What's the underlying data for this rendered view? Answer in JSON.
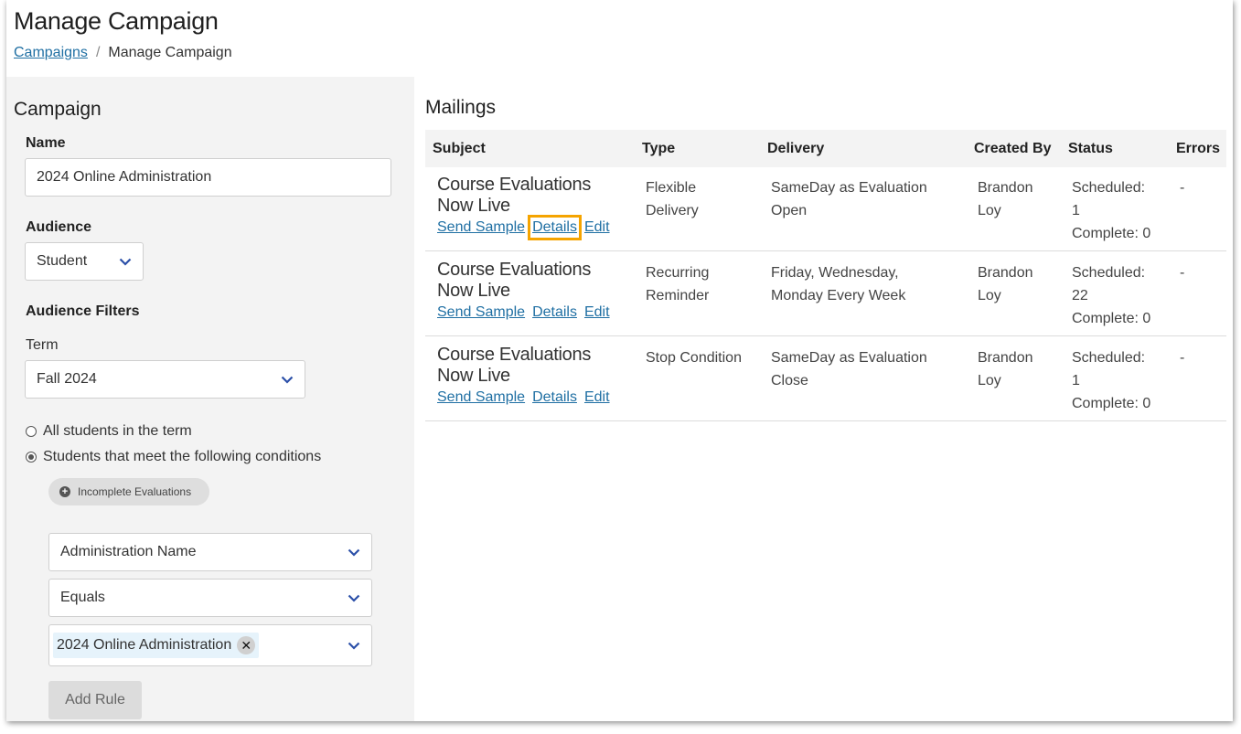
{
  "header": {
    "title": "Manage Campaign",
    "breadcrumb": {
      "link": "Campaigns",
      "separator": "/",
      "current": "Manage Campaign"
    }
  },
  "campaign": {
    "section_title": "Campaign",
    "name_label": "Name",
    "name_value": "2024 Online Administration",
    "audience_label": "Audience",
    "audience_value": "Student",
    "filters_label": "Audience Filters",
    "term_label": "Term",
    "term_value": "Fall 2024",
    "radio_all": "All students in the term",
    "radio_conditions": "Students that meet the following conditions",
    "selected_radio": "conditions",
    "condition_pill": "Incomplete Evaluations",
    "rule_field": "Administration Name",
    "rule_operator": "Equals",
    "rule_value_tag": "2024 Online Administration",
    "add_rule_label": "Add Rule"
  },
  "mailings": {
    "title": "Mailings",
    "columns": [
      "Subject",
      "Type",
      "Delivery",
      "Created By",
      "Status",
      "Errors"
    ],
    "rows": [
      {
        "subject_line1": "Course Evaluations",
        "subject_line2": "Now Live",
        "type_line1": "Flexible",
        "type_line2": "Delivery",
        "delivery_line1": "SameDay as Evaluation",
        "delivery_line2": "Open",
        "created_line1": "Brandon",
        "created_line2": "Loy",
        "status_line1": "Scheduled:",
        "status_line2": "1",
        "status_line3": "Complete: 0",
        "errors": "-",
        "links": {
          "sample": "Send Sample",
          "details": "Details",
          "edit": "Edit"
        }
      },
      {
        "subject_line1": "Course Evaluations",
        "subject_line2": "Now Live",
        "type_line1": "Recurring",
        "type_line2": "Reminder",
        "delivery_line1": "Friday, Wednesday,",
        "delivery_line2": "Monday Every Week",
        "created_line1": "Brandon",
        "created_line2": "Loy",
        "status_line1": "Scheduled:",
        "status_line2": "22",
        "status_line3": "Complete: 0",
        "errors": "-",
        "links": {
          "sample": "Send Sample",
          "details": "Details",
          "edit": "Edit"
        }
      },
      {
        "subject_line1": "Course Evaluations",
        "subject_line2": "Now Live",
        "type_line1": "Stop Condition",
        "type_line2": "",
        "delivery_line1": "SameDay as Evaluation",
        "delivery_line2": "Close",
        "created_line1": "Brandon",
        "created_line2": "Loy",
        "status_line1": "Scheduled:",
        "status_line2": "1",
        "status_line3": "Complete: 0",
        "errors": "-",
        "links": {
          "sample": "Send Sample",
          "details": "Details",
          "edit": "Edit"
        }
      }
    ]
  },
  "colors": {
    "link": "#1f6fa3",
    "highlight": "#f5a400",
    "panel_bg": "#f3f3f3",
    "chevron": "#2b4fa8"
  },
  "icons": [
    "chevron-down-icon",
    "plus-circle-icon",
    "remove-tag-icon"
  ]
}
